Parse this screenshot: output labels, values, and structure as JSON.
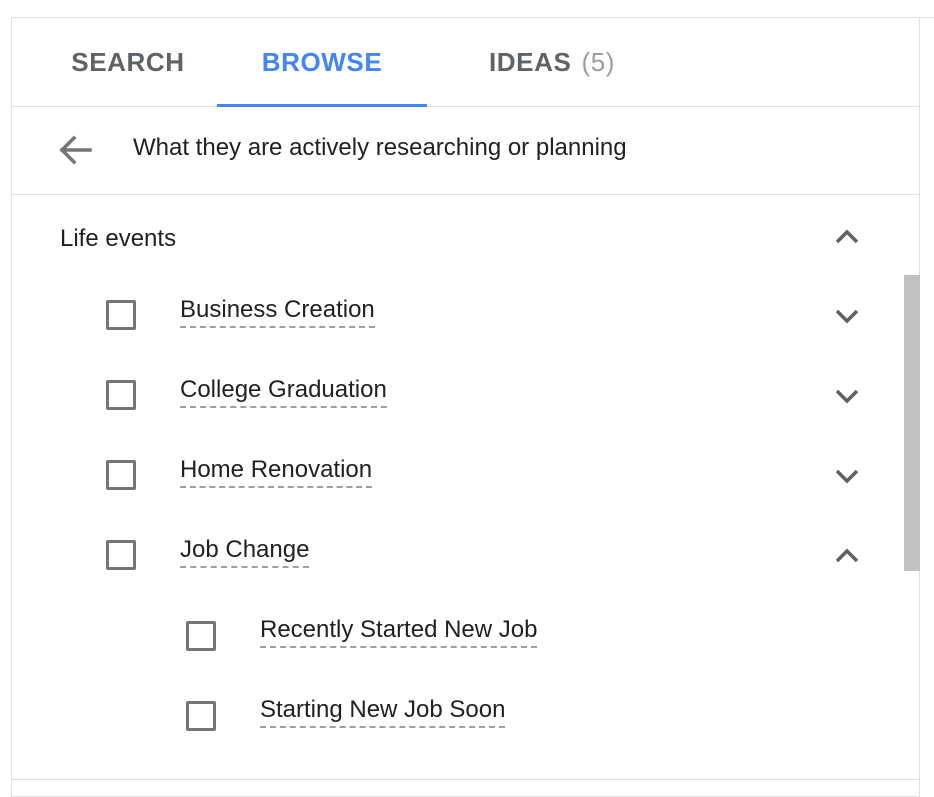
{
  "tabs": [
    {
      "label": "SEARCH",
      "count": ""
    },
    {
      "label": "BROWSE",
      "count": ""
    },
    {
      "label": "IDEAS",
      "count": "(5)"
    }
  ],
  "active_tab": "BROWSE",
  "colors": {
    "accent": "#4285f4",
    "text": "#212121",
    "muted": "#5f6368",
    "border": "#e0e0e0"
  },
  "breadcrumb": {
    "back_icon": "arrow-left-icon",
    "title": "What they are actively researching or planning"
  },
  "section": {
    "label": "Life events",
    "icon": "chevron-up-icon"
  },
  "items": [
    {
      "label": "Business Creation",
      "checked": false,
      "icon": "chevron-down-icon"
    },
    {
      "label": "College Graduation",
      "checked": false,
      "icon": "chevron-down-icon"
    },
    {
      "label": "Home Renovation",
      "checked": false,
      "icon": "chevron-down-icon"
    },
    {
      "label": "Job Change",
      "checked": false,
      "icon": "chevron-up-icon",
      "children": [
        {
          "label": "Recently Started New Job",
          "checked": false
        },
        {
          "label": "Starting New Job Soon",
          "checked": false
        }
      ]
    }
  ]
}
